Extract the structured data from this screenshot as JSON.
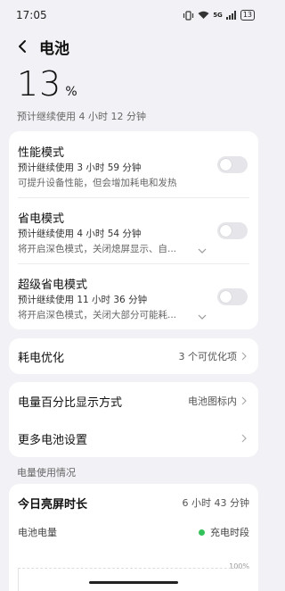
{
  "status_bar": {
    "time": "17:05",
    "network_label": "5G",
    "battery_level": "13"
  },
  "header": {
    "title": "电池"
  },
  "battery": {
    "percent": "13",
    "percent_unit": "%",
    "estimate": "预计继续使用 4 小时 12 分钟"
  },
  "modes": [
    {
      "title": "性能模式",
      "estimate": "预计继续使用 3 小时 59 分钟",
      "description": "可提升设备性能，但会增加耗电和发热",
      "enabled": false,
      "expandable": false
    },
    {
      "title": "省电模式",
      "estimate": "预计继续使用 4 小时 54 分钟",
      "description": "将开启深色模式，关闭熄屏显示、自...",
      "enabled": false,
      "expandable": true
    },
    {
      "title": "超级省电模式",
      "estimate": "预计继续使用 11 小时 36 分钟",
      "description": "将开启深色模式，关闭大部分可能耗...",
      "enabled": false,
      "expandable": true
    }
  ],
  "optimization": {
    "label": "耗电优化",
    "value": "3 个可优化项"
  },
  "display": {
    "label": "电量百分比显示方式",
    "value": "电池图标内"
  },
  "more": {
    "label": "更多电池设置"
  },
  "usage": {
    "section_title": "电量使用情况",
    "screen_on_label": "今日亮屏时长",
    "screen_on_value": "6 小时 43 分钟",
    "battery_level_label": "电池电量",
    "legend_charging": "充电时段",
    "y_max_label": "100%"
  },
  "colors": {
    "background": "#f2f2f6",
    "card": "#ffffff",
    "toggle_off": "#e5e5ea",
    "charging": "#33c25a"
  }
}
